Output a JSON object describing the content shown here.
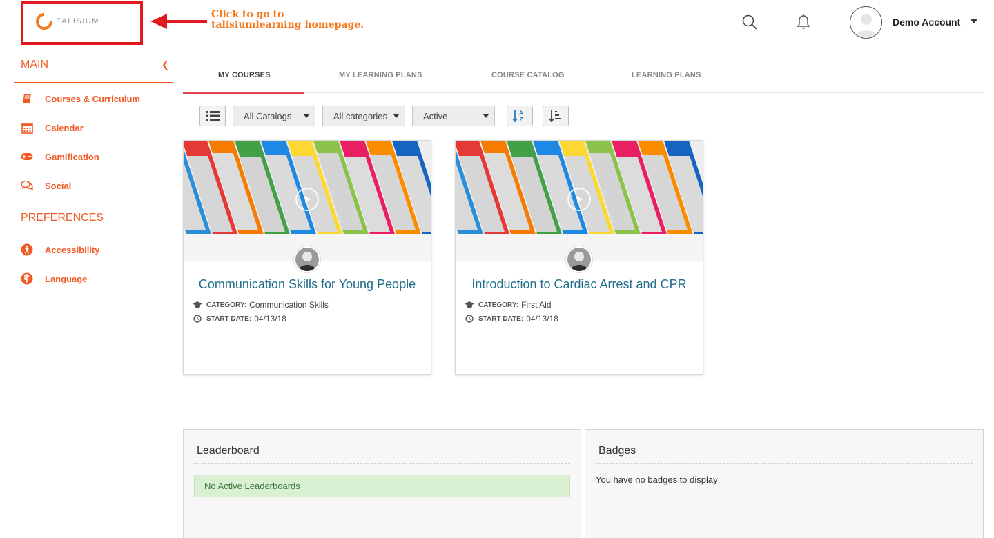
{
  "header": {
    "logo_text": "TALISIUM",
    "annotation": "Click to go to talisiumlearning homepage.",
    "user_name": "Demo Account",
    "icons": [
      "search-icon",
      "bell-icon",
      "user-avatar",
      "caret-down-icon"
    ]
  },
  "sidebar": {
    "main_heading": "MAIN",
    "main_items": [
      {
        "label": "Courses & Curriculum",
        "icon": "book-icon"
      },
      {
        "label": "Calendar",
        "icon": "calendar-icon"
      },
      {
        "label": "Gamification",
        "icon": "gamepad-icon"
      },
      {
        "label": "Social",
        "icon": "chat-icon"
      }
    ],
    "pref_heading": "PREFERENCES",
    "pref_items": [
      {
        "label": "Accessibility",
        "icon": "accessibility-icon"
      },
      {
        "label": "Language",
        "icon": "globe-icon"
      }
    ]
  },
  "tabs": [
    {
      "label": "MY COURSES",
      "active": true
    },
    {
      "label": "MY LEARNING PLANS",
      "active": false
    },
    {
      "label": "COURSE CATALOG",
      "active": false
    },
    {
      "label": "LEARNING PLANS",
      "active": false
    }
  ],
  "toolbar": {
    "catalog_select": "All Catalogs",
    "category_select": "All categories",
    "status_select": "Active"
  },
  "courses": [
    {
      "title": "Communication Skills for Young People",
      "category_label": "CATEGORY:",
      "category": "Communication Skills",
      "start_label": "START DATE:",
      "start_date": "04/13/18"
    },
    {
      "title": "Introduction to Cardiac Arrest and CPR",
      "category_label": "CATEGORY:",
      "category": "First Aid",
      "start_label": "START DATE:",
      "start_date": "04/13/18"
    }
  ],
  "leaderboard": {
    "title": "Leaderboard",
    "message": "No Active Leaderboards"
  },
  "badges": {
    "title": "Badges",
    "message": "You have no badges to display"
  },
  "colors": {
    "accent": "#f15a24",
    "tab_underline": "#e0414a",
    "link": "#1f6e8c",
    "annotation": "#e0191f",
    "success_bg": "#d9f0d3"
  }
}
